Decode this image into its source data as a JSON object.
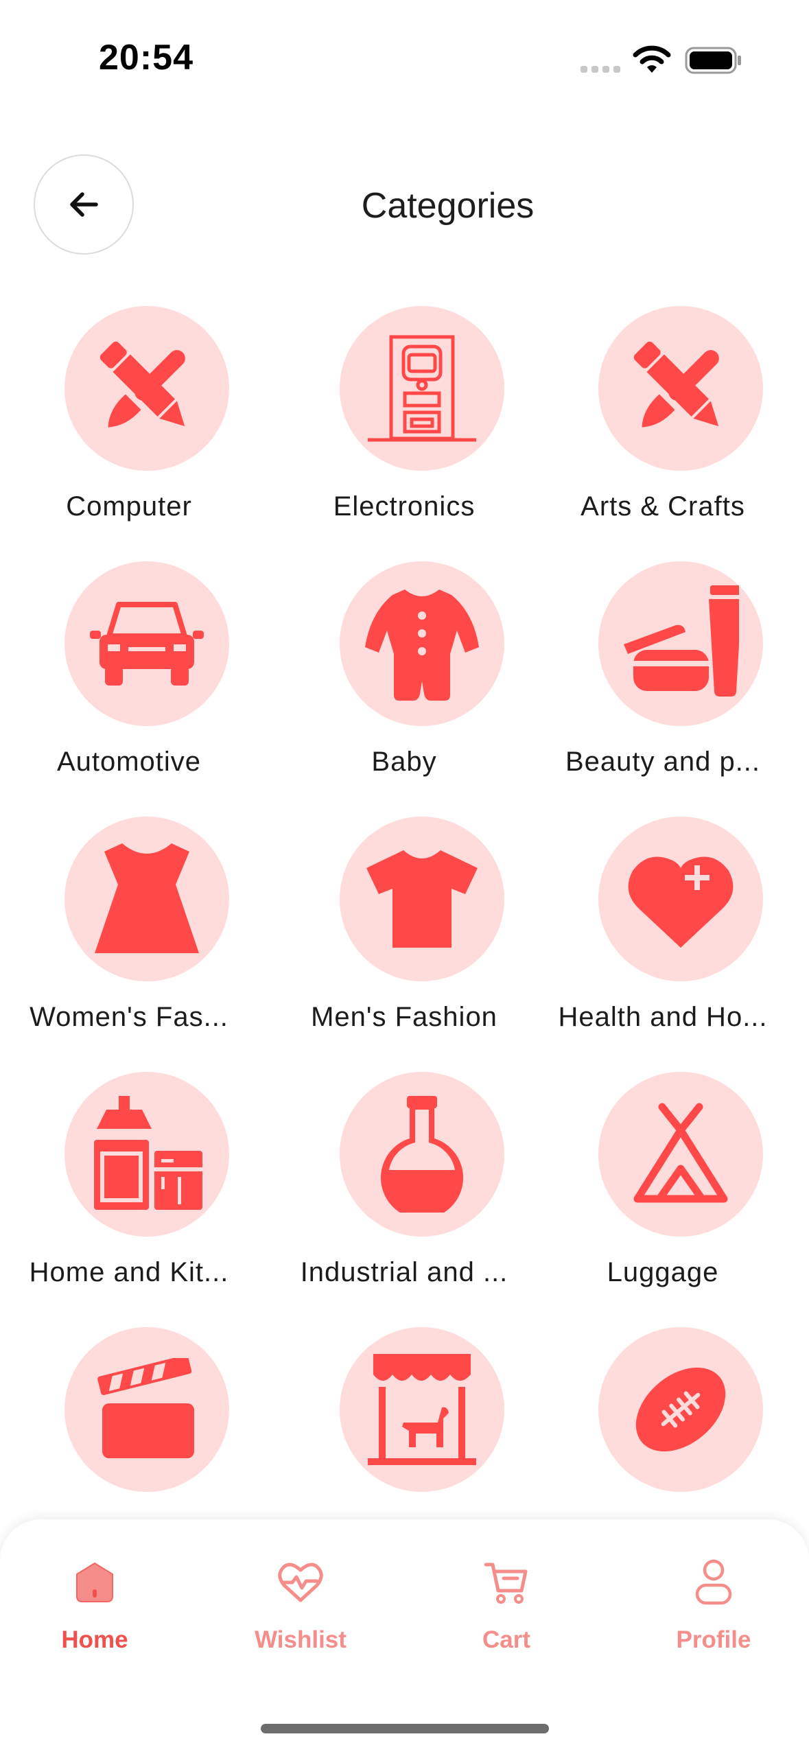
{
  "status_bar": {
    "time": "20:54",
    "icons": [
      "cellular-signal-icon",
      "wifi-icon",
      "battery-icon"
    ]
  },
  "header": {
    "title": "Categories",
    "back_icon": "arrow-left-icon"
  },
  "colors": {
    "accent": "#ff4848",
    "circle_bg": "#ffdcdc",
    "nav_active": "#f0504e",
    "nav_inactive": "#f58e8b"
  },
  "categories": [
    {
      "label": "Computer",
      "icon": "pencil-brush-icon"
    },
    {
      "label": "Electronics",
      "icon": "atm-kiosk-icon"
    },
    {
      "label": "Arts & Crafts",
      "icon": "pencil-brush-icon"
    },
    {
      "label": "Automotive",
      "icon": "car-icon"
    },
    {
      "label": "Baby",
      "icon": "baby-onesie-icon"
    },
    {
      "label": "Beauty and p...",
      "icon": "cosmetics-icon"
    },
    {
      "label": "Women's Fas...",
      "icon": "dress-icon"
    },
    {
      "label": "Men's Fashion",
      "icon": "tshirt-icon"
    },
    {
      "label": "Health and Ho...",
      "icon": "heart-plus-icon"
    },
    {
      "label": "Home and Kit...",
      "icon": "kitchen-icon"
    },
    {
      "label": "Industrial and ...",
      "icon": "flask-icon"
    },
    {
      "label": "Luggage",
      "icon": "tent-icon"
    },
    {
      "label": "",
      "icon": "clapperboard-icon"
    },
    {
      "label": "",
      "icon": "pet-store-icon"
    },
    {
      "label": "",
      "icon": "football-icon"
    }
  ],
  "bottom_nav": {
    "items": [
      {
        "label": "Home",
        "icon": "home-icon",
        "active": true
      },
      {
        "label": "Wishlist",
        "icon": "heart-pulse-icon",
        "active": false
      },
      {
        "label": "Cart",
        "icon": "cart-icon",
        "active": false
      },
      {
        "label": "Profile",
        "icon": "user-icon",
        "active": false
      }
    ]
  }
}
